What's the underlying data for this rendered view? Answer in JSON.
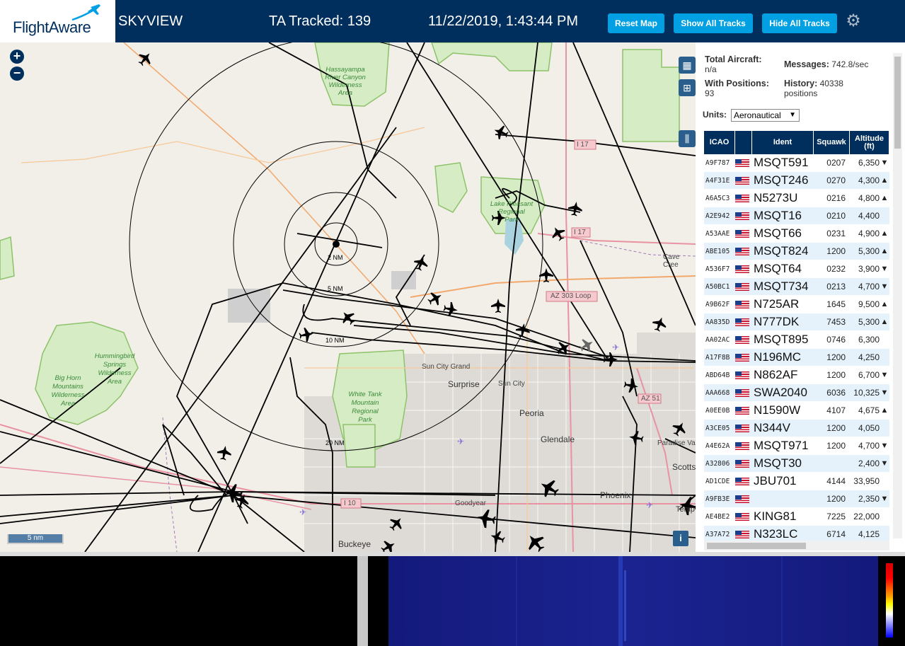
{
  "header": {
    "logo_text": "FlightAware",
    "title": "SKYVIEW",
    "tracked": "TA Tracked: 139",
    "datetime": "11/22/2019, 1:43:44 PM",
    "buttons": {
      "reset": "Reset Map",
      "show": "Show All Tracks",
      "hide": "Hide All Tracks"
    }
  },
  "map": {
    "zoom_in": "+",
    "zoom_out": "−",
    "scale": "5 nm",
    "info": "i",
    "ring_labels": [
      "2 NM",
      "5 NM",
      "10 NM",
      "20 NM"
    ],
    "place_labels": {
      "hassayampa": "Hassayampa\nRiver Canyon\nWilderness\nArea",
      "lake_pleasant": "Lake Pleasant\nRegional\nPark",
      "hummingbird": "Hummingbird\nSprings\nWilderness\nArea",
      "big_horn": "Big Horn\nMountains\nWilderness\nArea",
      "white_tank": "White Tank\nMountain\nRegional\nPark",
      "sun_city_grand": "Sun City Grand",
      "surprise": "Surprise",
      "sun_city": "Sun City",
      "peoria": "Peoria",
      "glendale": "Glendale",
      "phoenix": "Phoenix",
      "goodyear": "Goodyear",
      "buckeye": "Buckeye",
      "paradise_valley": "Paradise Va",
      "scottsdale": "Scotts",
      "cave_creek": "Cave Cree",
      "tempe": "Temp"
    },
    "road_labels": {
      "i17a": "I 17",
      "i17b": "I 17",
      "az303": "AZ 303 Loop",
      "az51": "AZ 51",
      "i10": "I 10"
    }
  },
  "stats": {
    "total_label": "Total Aircraft:",
    "total_value": "n/a",
    "messages_label": "Messages:",
    "messages_value": "742.8/sec",
    "positions_label": "With Positions:",
    "positions_value": "93",
    "history_label": "History:",
    "history_value": "40338",
    "history_unit": "positions",
    "units_label": "Units:",
    "units_value": "Aeronautical"
  },
  "table": {
    "headers": {
      "icao": "ICAO",
      "ident": "Ident",
      "squawk": "Squawk",
      "altitude": "Altitude (ft)"
    },
    "rows": [
      {
        "icao": "A9F787",
        "ident": "MSQT591",
        "squawk": "0207",
        "alt": "6,350",
        "trend": "▼"
      },
      {
        "icao": "A4F31E",
        "ident": "MSQT246",
        "squawk": "0270",
        "alt": "4,300",
        "trend": "▲"
      },
      {
        "icao": "A6A5C3",
        "ident": "N5273U",
        "squawk": "0216",
        "alt": "4,800",
        "trend": "▲"
      },
      {
        "icao": "A2E942",
        "ident": "MSQT16",
        "squawk": "0210",
        "alt": "4,400",
        "trend": ""
      },
      {
        "icao": "A53AAE",
        "ident": "MSQT66",
        "squawk": "0231",
        "alt": "4,900",
        "trend": "▲"
      },
      {
        "icao": "ABE105",
        "ident": "MSQT824",
        "squawk": "1200",
        "alt": "5,300",
        "trend": "▲"
      },
      {
        "icao": "A536F7",
        "ident": "MSQT64",
        "squawk": "0232",
        "alt": "3,900",
        "trend": "▼"
      },
      {
        "icao": "A50BC1",
        "ident": "MSQT734",
        "squawk": "0213",
        "alt": "4,700",
        "trend": "▼"
      },
      {
        "icao": "A9B62F",
        "ident": "N725AR",
        "squawk": "1645",
        "alt": "9,500",
        "trend": "▲"
      },
      {
        "icao": "AA835D",
        "ident": "N777DK",
        "squawk": "7453",
        "alt": "5,300",
        "trend": "▲"
      },
      {
        "icao": "AA02AC",
        "ident": "MSQT895",
        "squawk": "0746",
        "alt": "6,300",
        "trend": ""
      },
      {
        "icao": "A17F8B",
        "ident": "N196MC",
        "squawk": "1200",
        "alt": "4,250",
        "trend": ""
      },
      {
        "icao": "ABD64B",
        "ident": "N862AF",
        "squawk": "1200",
        "alt": "6,700",
        "trend": "▼"
      },
      {
        "icao": "AAA668",
        "ident": "SWA2040",
        "squawk": "6036",
        "alt": "10,325",
        "trend": "▼"
      },
      {
        "icao": "A0EE0B",
        "ident": "N1590W",
        "squawk": "4107",
        "alt": "4,675",
        "trend": "▲"
      },
      {
        "icao": "A3CE05",
        "ident": "N344V",
        "squawk": "1200",
        "alt": "4,050",
        "trend": ""
      },
      {
        "icao": "A4E62A",
        "ident": "MSQT971",
        "squawk": "1200",
        "alt": "4,700",
        "trend": "▼"
      },
      {
        "icao": "A32806",
        "ident": "MSQT30",
        "squawk": "",
        "alt": "2,400",
        "trend": "▼"
      },
      {
        "icao": "AD1CDE",
        "ident": "JBU701",
        "squawk": "4144",
        "alt": "33,950",
        "trend": ""
      },
      {
        "icao": "A9FB3E",
        "ident": "",
        "squawk": "1200",
        "alt": "2,350",
        "trend": "▼"
      },
      {
        "icao": "AE4BE2",
        "ident": "KING81",
        "squawk": "7225",
        "alt": "22,000",
        "trend": ""
      },
      {
        "icao": "A37A72",
        "ident": "N323LC",
        "squawk": "6714",
        "alt": "4,125",
        "trend": ""
      }
    ]
  },
  "colors": {
    "header_bg": "#002f5d",
    "button": "#00a0e2",
    "map_bg": "#f2efe9",
    "park": "#d6ecc5",
    "urban": "#dcdcdc"
  }
}
